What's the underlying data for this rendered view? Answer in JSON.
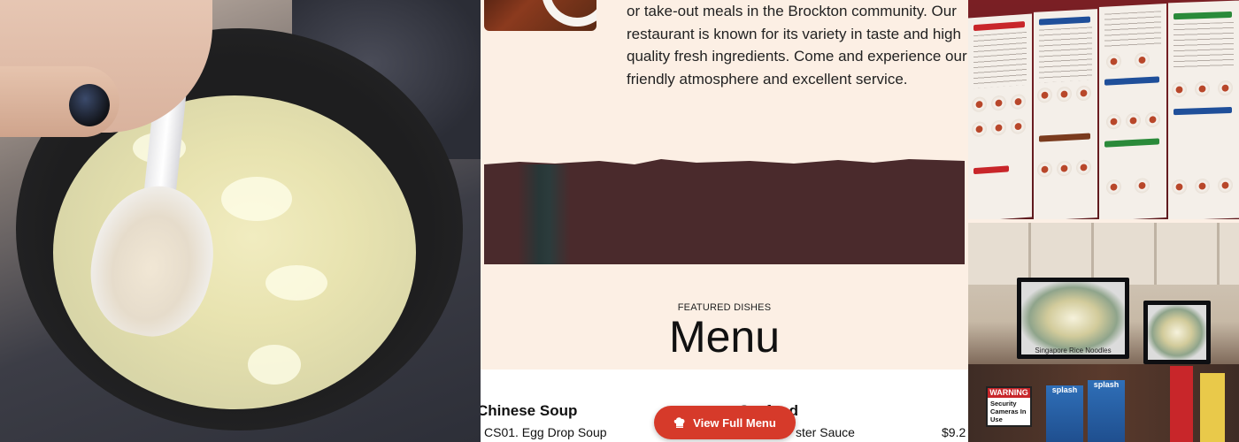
{
  "about": {
    "text": "or take-out meals in the Brockton community. Our restaurant is known for its variety in taste and high quality fresh ingredients. Come and experience our friendly atmosphere and excellent service."
  },
  "menu_section": {
    "eyebrow": "FEATURED DISHES",
    "title": "Menu",
    "categories": [
      {
        "name": "Chinese Soup",
        "items": [
          {
            "name": "CS01. Egg Drop Soup",
            "price": ""
          }
        ]
      },
      {
        "name": "Seafood",
        "items": [
          {
            "name": "ster Sauce",
            "price": "$9.2"
          }
        ]
      }
    ],
    "view_button": "View Full Menu"
  },
  "restaurant_photo": {
    "tv_caption": "Singapore Rice Noodles",
    "warning_title": "WARNING",
    "warning_text": "Security Cameras In Use",
    "splash_label": "splash"
  },
  "menu_photo": {
    "section_titles": [
      "SALT & PEPPER",
      "SEAFOOD",
      "FRIED RICE",
      "CHOP SUEY/EGG FOO YANG CHOW MEIN",
      "CHICKEN",
      "VEGETABLE",
      "NOODLE",
      "CHINESE SOUP"
    ],
    "colors": {
      "red": "#c8262a",
      "blue": "#1f4f9a",
      "green": "#2a8a3a",
      "brown": "#7a3b1e"
    }
  },
  "colors": {
    "page_bg": "#fcefe4",
    "banner": "#4a2a2c",
    "button": "#d63a2a"
  },
  "icons": [
    "chef-hat-icon"
  ]
}
